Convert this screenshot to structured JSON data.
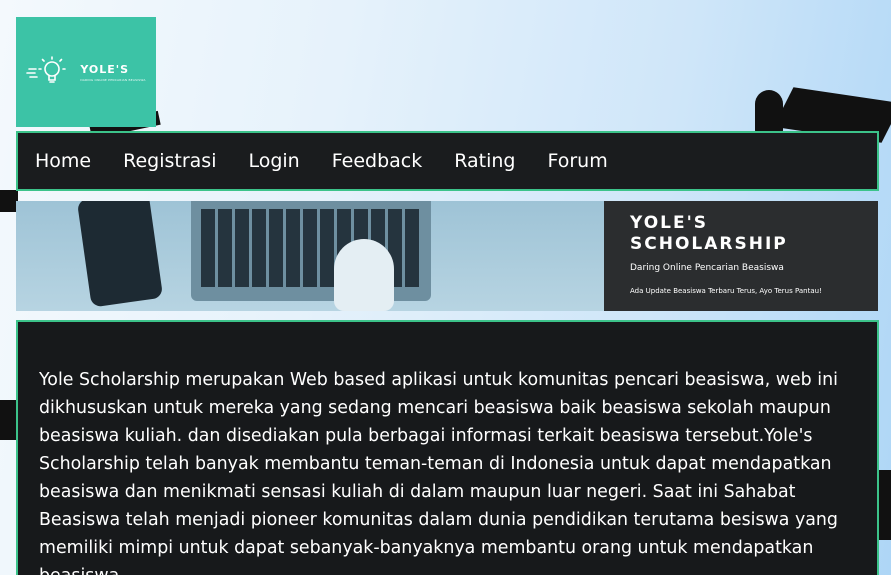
{
  "logo": {
    "title": "YOLE'S",
    "subtitle": "DARING ONLINE PENCARIAN BEASISWA"
  },
  "nav": {
    "items": [
      {
        "label": "Home"
      },
      {
        "label": "Registrasi"
      },
      {
        "label": "Login"
      },
      {
        "label": "Feedback"
      },
      {
        "label": "Rating"
      },
      {
        "label": "Forum"
      }
    ]
  },
  "banner": {
    "title_line1": "YOLE'S",
    "title_line2": "SCHOLARSHIP",
    "subtitle": "Daring Online Pencarian Beasiswa",
    "note": "Ada Update Beasiswa Terbaru Terus, Ayo Terus Pantau!"
  },
  "content": {
    "text": "Yole Scholarship merupakan Web based aplikasi untuk komunitas pencari beasiswa, web ini dikhususkan untuk mereka yang sedang mencari beasiswa baik beasiswa sekolah maupun beasiswa kuliah. dan disediakan pula berbagai informasi terkait beasiswa tersebut.Yole's Scholarship telah banyak membantu teman-teman di Indonesia untuk dapat mendapatkan beasiswa dan menikmati sensasi kuliah di dalam maupun luar negeri. Saat ini Sahabat Beasiswa telah menjadi pioneer komunitas dalam dunia pendidikan terutama besiswa yang memiliki mimpi untuk dapat sebanyak-banyaknya membantu orang untuk mendapatkan beasiswa."
  },
  "colors": {
    "accent": "#3cc38a",
    "logo_bg": "#3cc3a6",
    "panel_bg": "#17191b"
  }
}
